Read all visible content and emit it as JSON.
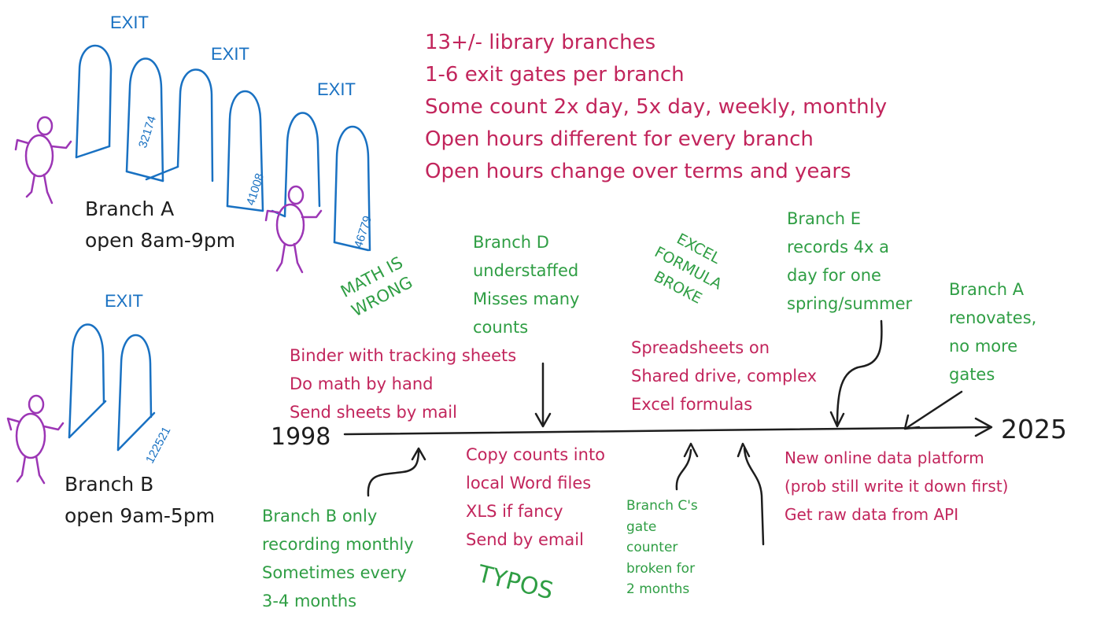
{
  "exit_label": "EXIT",
  "gates": {
    "g1": "32174",
    "g2": "41008",
    "g3": "46779",
    "g4": "122521"
  },
  "branch_a": {
    "name": "Branch A",
    "hours": "open 8am-9pm"
  },
  "branch_b": {
    "name": "Branch B",
    "hours": "open 9am-5pm"
  },
  "facts": [
    "13+/- library branches",
    "1-6 exit gates per branch",
    "Some count 2x day, 5x day, weekly, monthly",
    "Open hours different for every branch",
    "Open hours change over terms and years"
  ],
  "timeline": {
    "start": "1998",
    "end": "2025"
  },
  "above": {
    "math_wrong": [
      "MATH IS",
      "WRONG"
    ],
    "branch_d": [
      "Branch D",
      "understaffed",
      "Misses many",
      "counts"
    ],
    "excel_broke": [
      "EXCEL",
      "FORMULA",
      "BROKE"
    ],
    "branch_e": [
      "Branch E",
      "records 4x a",
      "day for one",
      "spring/summer"
    ],
    "branch_a_reno": [
      "Branch A",
      "renovates,",
      "no more",
      "gates"
    ],
    "binder": [
      "Binder with tracking sheets",
      "Do math by hand",
      "Send sheets by mail"
    ],
    "spreadsheets": [
      "Spreadsheets on",
      "Shared drive, complex",
      "Excel formulas"
    ]
  },
  "below": {
    "branch_b_monthly": [
      "Branch B only",
      "recording monthly",
      "Sometimes every",
      "3-4 months"
    ],
    "word_files": [
      "Copy counts into",
      "local Word files",
      "XLS if fancy",
      "Send by email"
    ],
    "typos": "TYPOS",
    "branch_c": [
      "Branch C's",
      "gate",
      "counter",
      "broken for",
      "2 months"
    ],
    "platform": [
      "New online data platform",
      "(prob still write it down first)",
      "Get raw data from API"
    ]
  },
  "colors": {
    "red": "#c2255c",
    "green": "#2f9e44",
    "blue": "#1971c2",
    "purple": "#9c36b5",
    "black": "#1e1e1e"
  }
}
